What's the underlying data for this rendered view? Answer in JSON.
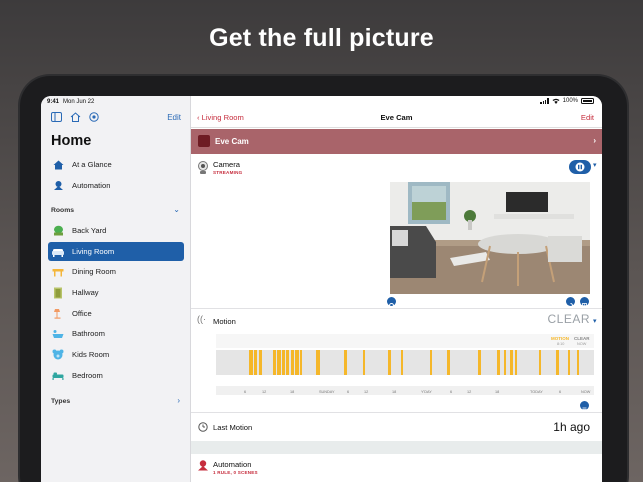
{
  "headline": "Get the full picture",
  "status_bar": {
    "time": "9:41",
    "date": "Mon Jun 22",
    "battery": "100%"
  },
  "sidebar": {
    "edit_label": "Edit",
    "title": "Home",
    "top_items": [
      {
        "label": "At a Glance",
        "icon": "house-icon"
      },
      {
        "label": "Automation",
        "icon": "automation-icon"
      }
    ],
    "rooms_section": "Rooms",
    "rooms": [
      {
        "label": "Back Yard",
        "icon": "tree-icon"
      },
      {
        "label": "Living Room",
        "icon": "sofa-icon",
        "active": true
      },
      {
        "label": "Dining Room",
        "icon": "table-icon"
      },
      {
        "label": "Hallway",
        "icon": "door-icon"
      },
      {
        "label": "Office",
        "icon": "lamp-icon"
      },
      {
        "label": "Bathroom",
        "icon": "shower-icon"
      },
      {
        "label": "Kids Room",
        "icon": "teddy-icon"
      },
      {
        "label": "Bedroom",
        "icon": "bed-icon"
      }
    ],
    "types_section": "Types"
  },
  "main": {
    "back_label": "Living Room",
    "title": "Eve Cam",
    "edit_label": "Edit",
    "accessory_name": "Eve Cam",
    "camera": {
      "label": "Camera",
      "status": "STREAMING"
    },
    "motion": {
      "label": "Motion",
      "state": "CLEAR",
      "legend_motion": "MOTION",
      "legend_motion_time": "8:10",
      "legend_clear": "CLEAR",
      "legend_clear_time": "NOW",
      "axis_labels": [
        "6",
        "12",
        "18",
        "SUNDAY",
        "6",
        "12",
        "18",
        "Y'DAY",
        "6",
        "12",
        "18",
        "TODAY",
        "6",
        "NOW"
      ]
    },
    "last_motion": {
      "label": "Last Motion",
      "value": "1h ago"
    },
    "automation": {
      "label": "Automation",
      "sub": "1 RULE, 0 SCENES"
    }
  },
  "colors": {
    "accent_blue": "#1f5fa8",
    "accent_red": "#c62d3d",
    "motion_yellow": "#f5b72a"
  }
}
